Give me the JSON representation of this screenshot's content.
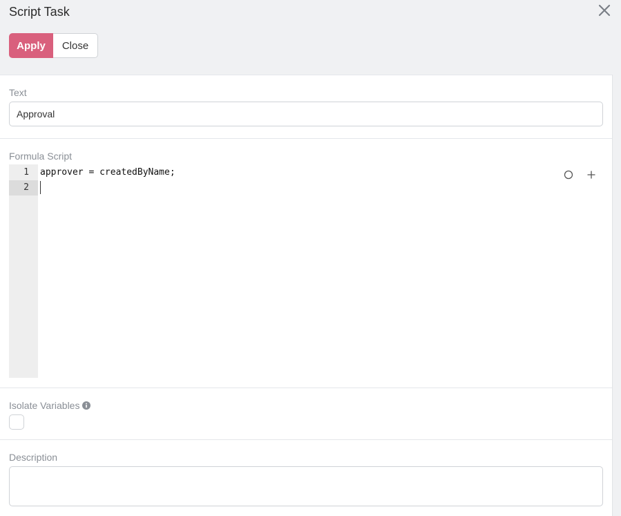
{
  "dialog": {
    "title": "Script Task",
    "close_icon": "close-x-icon"
  },
  "toolbar": {
    "apply_label": "Apply",
    "close_label": "Close",
    "accent_color": "#d9607d"
  },
  "fields": {
    "text": {
      "label": "Text",
      "value": "Approval"
    },
    "formula": {
      "label": "Formula Script",
      "line_numbers": [
        "1",
        "2"
      ],
      "lines": [
        "approver = createdByName;",
        ""
      ],
      "active_line": "2",
      "icons": [
        "circle-icon",
        "plus-icon"
      ]
    },
    "isolate": {
      "label": "Isolate Variables",
      "info_icon": "info-icon",
      "checked": false
    },
    "description": {
      "label": "Description",
      "value": ""
    }
  }
}
